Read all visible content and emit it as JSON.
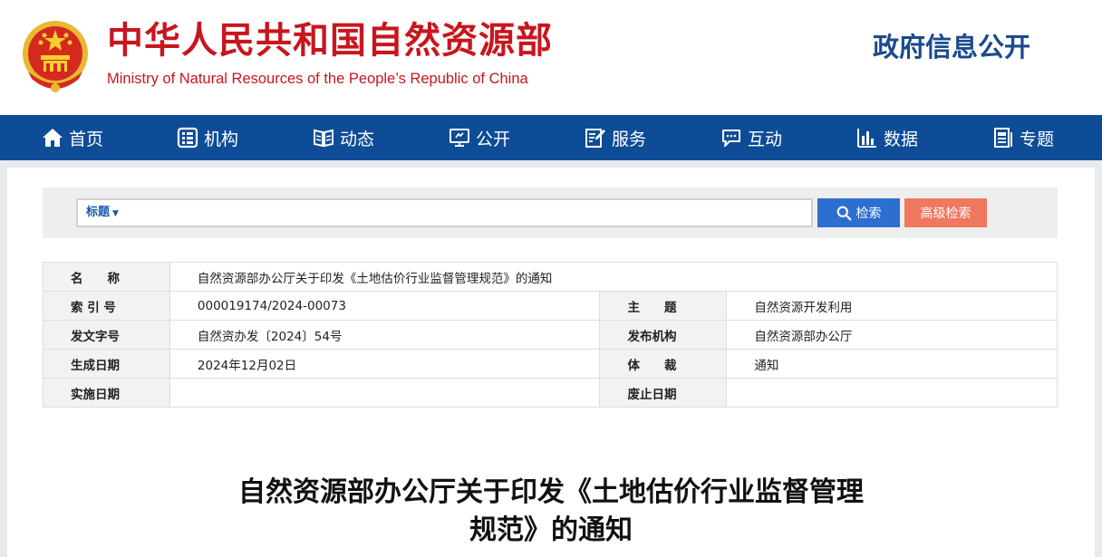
{
  "header": {
    "site_title": "中华人民共和国自然资源部",
    "site_subtitle": "Ministry of Natural Resources of the People’s Republic of China",
    "portal_title": "政府信息公开",
    "brand_red": "#c8161e",
    "brand_blue": "#1a4a8c"
  },
  "nav": {
    "bg_color": "#0e4c97",
    "items": [
      {
        "label": "首页",
        "icon": "home-icon"
      },
      {
        "label": "机构",
        "icon": "org-icon"
      },
      {
        "label": "动态",
        "icon": "book-icon"
      },
      {
        "label": "公开",
        "icon": "monitor-icon"
      },
      {
        "label": "服务",
        "icon": "edit-icon"
      },
      {
        "label": "互动",
        "icon": "chat-icon"
      },
      {
        "label": "数据",
        "icon": "bar-chart-icon"
      },
      {
        "label": "专题",
        "icon": "document-icon"
      }
    ]
  },
  "search": {
    "scope_label": "标题",
    "input_value": "",
    "search_button": "检索",
    "advanced_button": "高级检索"
  },
  "meta": {
    "name_label": "名　　称",
    "name_value": "自然资源部办公厅关于印发《土地估价行业监督管理规范》的通知",
    "index_label": "索 引 号",
    "index_value": "000019174/2024-00073",
    "subject_label": "主　　题",
    "subject_value": "自然资源开发利用",
    "doc_no_label": "发文字号",
    "doc_no_value": "自然资办发〔2024〕54号",
    "issuer_label": "发布机构",
    "issuer_value": "自然资源部办公厅",
    "created_label": "生成日期",
    "created_value": "2024年12月02日",
    "genre_label": "体　　裁",
    "genre_value": "通知",
    "effective_label": "实施日期",
    "effective_value": "",
    "expiry_label": "废止日期",
    "expiry_value": ""
  },
  "article": {
    "title_line1": "自然资源部办公厅关于印发《土地估价行业监督管理",
    "title_line2": "规范》的通知"
  }
}
